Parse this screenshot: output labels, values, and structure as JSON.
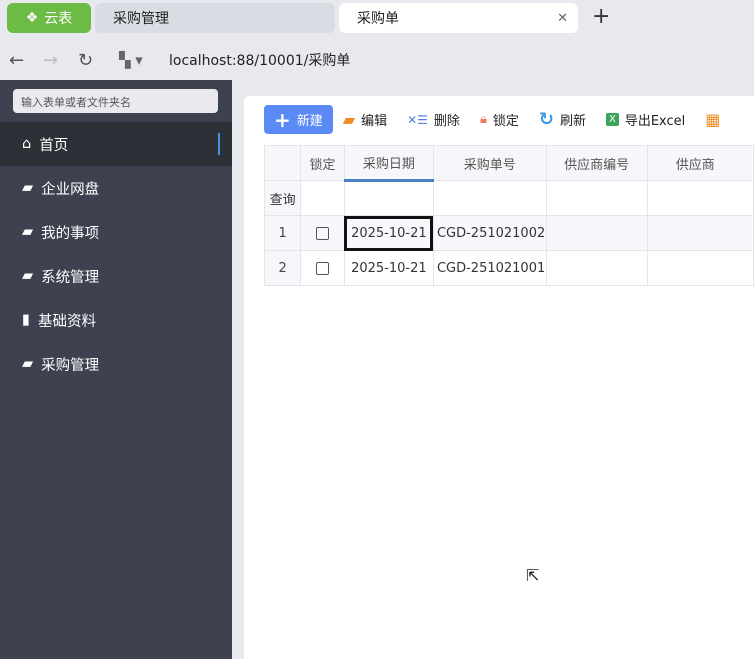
{
  "browser": {
    "app_tab": "云表",
    "tabs": [
      {
        "label": "采购管理"
      },
      {
        "label": "采购单"
      }
    ],
    "url": "localhost:88/10001/采购单"
  },
  "sidebar": {
    "search_placeholder": "输入表单或者文件夹名",
    "items": [
      {
        "label": "首页",
        "icon": "home-icon",
        "active": true
      },
      {
        "label": "企业网盘",
        "icon": "folder-icon"
      },
      {
        "label": "我的事项",
        "icon": "folder-icon"
      },
      {
        "label": "系统管理",
        "icon": "folder-icon"
      },
      {
        "label": "基础资料",
        "icon": "clipboard-icon"
      },
      {
        "label": "采购管理",
        "icon": "folder-icon"
      }
    ]
  },
  "toolbar": {
    "new": "新建",
    "edit": "编辑",
    "delete": "删除",
    "lock": "锁定",
    "refresh": "刷新",
    "export": "导出Excel"
  },
  "grid": {
    "headers": [
      "",
      "锁定",
      "采购日期",
      "采购单号",
      "供应商编号",
      "供应商"
    ],
    "query_label": "查询",
    "rows": [
      {
        "no": "1",
        "locked": false,
        "date": "2025-10-21",
        "order": "CGD-251021002"
      },
      {
        "no": "2",
        "locked": false,
        "date": "2025-10-21",
        "order": "CGD-251021001"
      }
    ]
  }
}
